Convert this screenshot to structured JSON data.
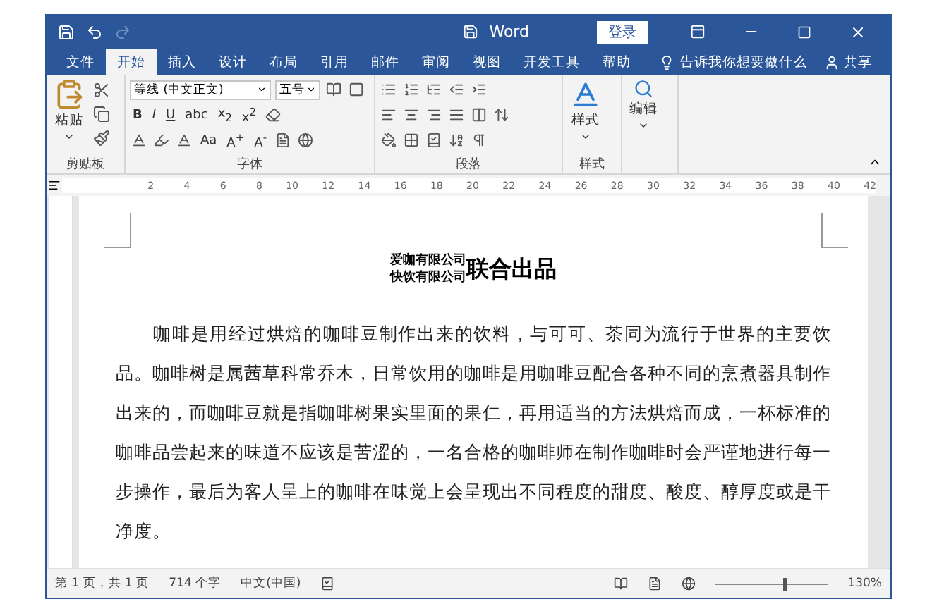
{
  "title_bar": {
    "title": "Word",
    "sign_in": "登录"
  },
  "tabs": [
    {
      "label": "文件",
      "selected": false
    },
    {
      "label": "开始",
      "selected": true
    },
    {
      "label": "插入",
      "selected": false
    },
    {
      "label": "设计",
      "selected": false
    },
    {
      "label": "布局",
      "selected": false
    },
    {
      "label": "引用",
      "selected": false
    },
    {
      "label": "邮件",
      "selected": false
    },
    {
      "label": "审阅",
      "selected": false
    },
    {
      "label": "视图",
      "selected": false
    },
    {
      "label": "开发工具",
      "selected": false
    },
    {
      "label": "帮助",
      "selected": false
    }
  ],
  "tell_me": "告诉我你想要做什么",
  "share": "共享",
  "ribbon": {
    "clipboard": {
      "paste": "粘贴",
      "label": "剪贴板"
    },
    "font": {
      "name": "等线 (中文正文)",
      "size": "五号",
      "format_buttons": [
        "B",
        "I",
        "U",
        "abc",
        "x$_{2}$",
        "x$^{2}$"
      ],
      "effect_buttons": [
        "Aa",
        "A$^{+}$",
        "A$^{-}$"
      ],
      "label": "字体"
    },
    "paragraph": {
      "label": "段落"
    },
    "styles": {
      "button": "样式",
      "label": "样式"
    },
    "editing": {
      "button": "编辑"
    }
  },
  "ruler": {
    "marks": [
      "2",
      "4",
      "6",
      "8",
      "10",
      "12",
      "14",
      "16",
      "18",
      "20",
      "22",
      "24",
      "26",
      "28",
      "30",
      "32",
      "34",
      "36",
      "38",
      "40",
      "42"
    ]
  },
  "document": {
    "title_companies": [
      "爱咖有限公司",
      "快饮有限公司"
    ],
    "title_main": "联合出品",
    "paragraph": "咖啡是用经过烘焙的咖啡豆制作出来的饮料，与可可、茶同为流行于世界的主要饮品。咖啡树是属茜草科常乔木，日常饮用的咖啡是用咖啡豆配合各种不同的烹煮器具制作出来的，而咖啡豆就是指咖啡树果实里面的果仁，再用适当的方法烘焙而成，一杯标准的咖啡品尝起来的味道不应该是苦涩的，一名合格的咖啡师在制作咖啡时会严谨地进行每一步操作，最后为客人呈上的咖啡在味觉上会呈现出不同程度的甜度、酸度、醇厚度或是干净度。"
  },
  "status_bar": {
    "page": "第 1 页，共 1 页",
    "words": "714 个字",
    "language": "中文(中国)",
    "zoom_slider": {
      "level": 0.6
    },
    "zoom": "130%"
  }
}
